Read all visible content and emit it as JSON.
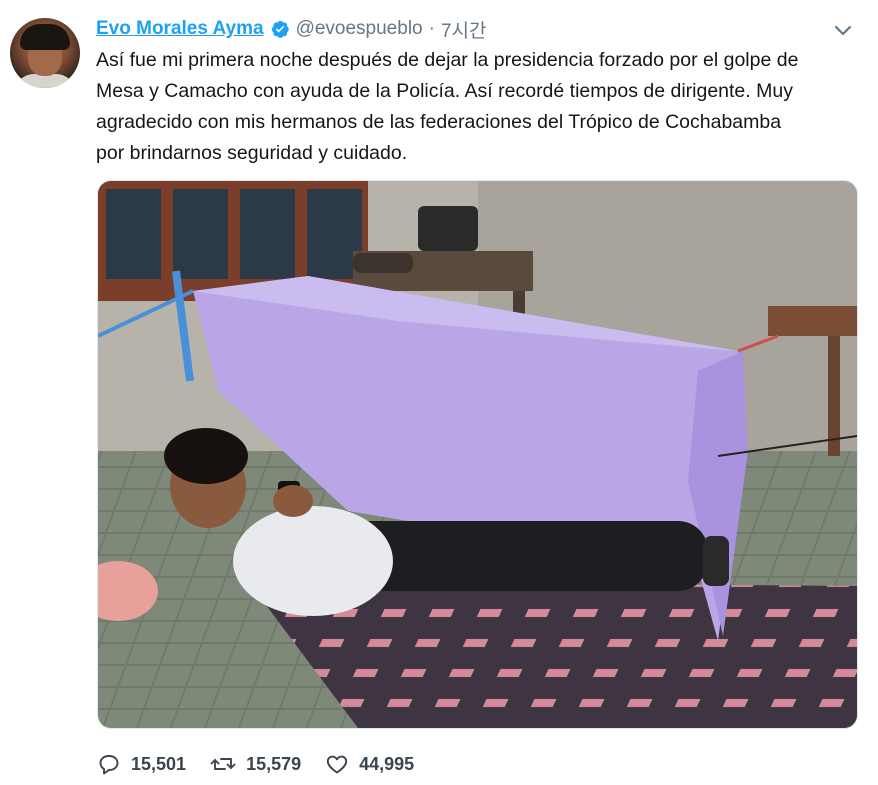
{
  "tweet": {
    "author_name": "Evo Morales Ayma",
    "handle": "@evoespueblo",
    "separator": "·",
    "time": "7시간",
    "text_lines": [
      "Así fue mi primera noche después de dejar la presidencia forzado por el golpe de",
      "Mesa y Camacho con ayuda de la Policía. Así recordé tiempos de dirigente. Muy",
      "agradecido con mis hermanos de las federaciones del Trópico de Cochabamba",
      "por brindarnos seguridad y cuidado."
    ],
    "media": {
      "description_icon": "photo"
    },
    "actions": {
      "replies": "15,501",
      "retweets": "15,579",
      "likes": "44,995"
    },
    "icons": {
      "verified": "verified-badge-icon",
      "menu": "chevron-down-icon",
      "reply": "reply-icon",
      "retweet": "retweet-icon",
      "like": "heart-icon"
    }
  },
  "colors": {
    "accent": "#1da1f2",
    "secondary_text": "#657786",
    "action_text": "#3a4550"
  }
}
